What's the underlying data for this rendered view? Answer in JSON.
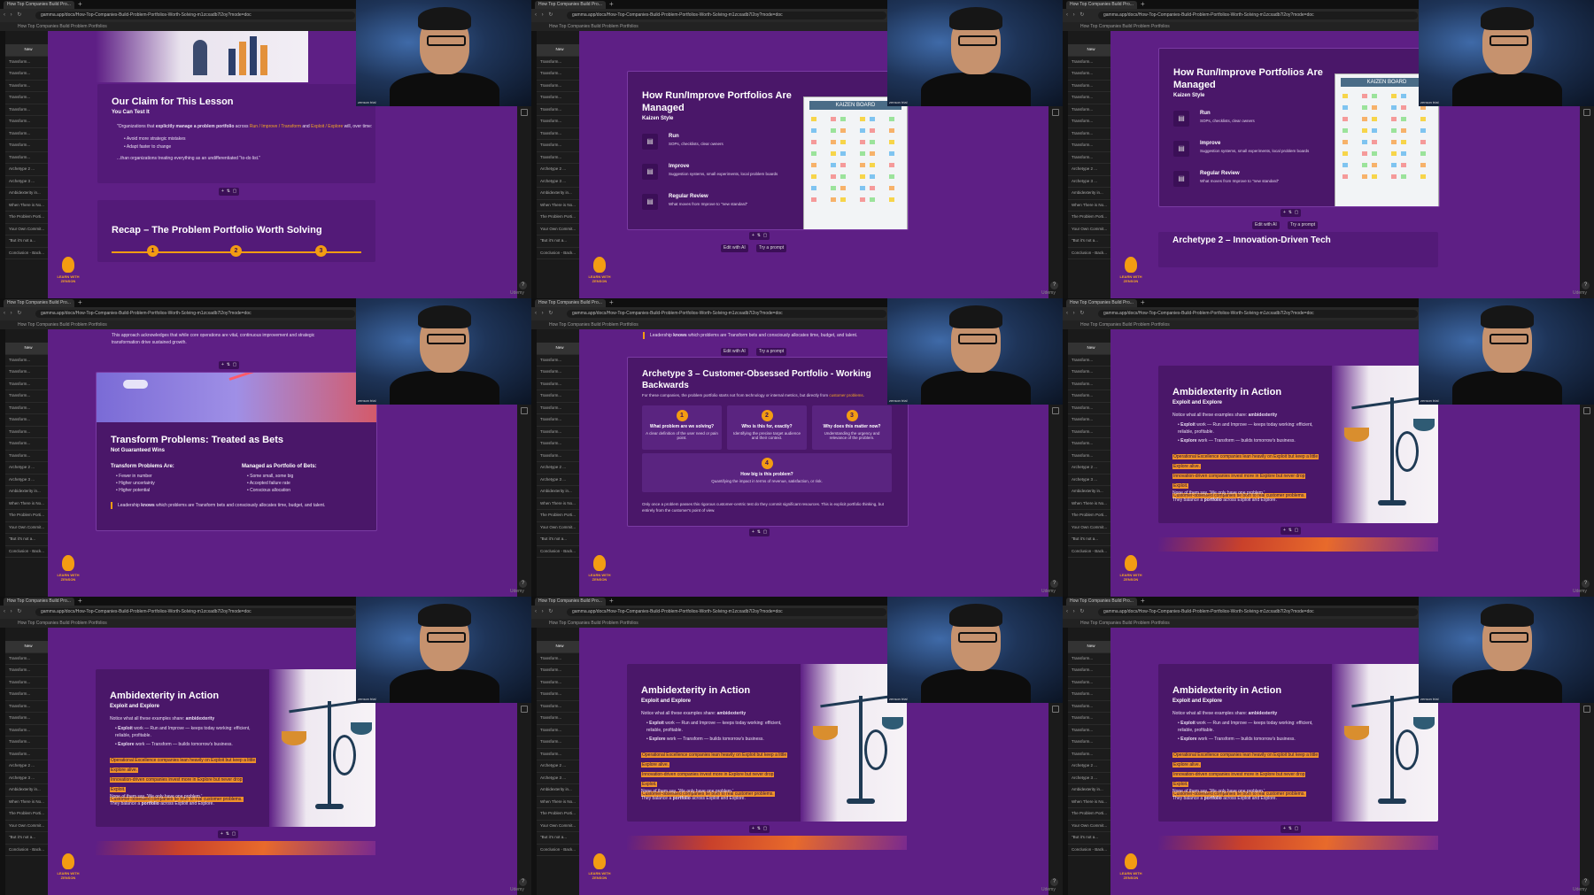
{
  "browser": {
    "tab_title": "How Top Companies Build Pro...",
    "url": "gamma.app/docs/How-Top-Companies-Build-Problem-Portfolios-Worth-Solving-m1zcxadb7l2oy?mode=doc",
    "breadcrumb": "How Top Companies Build Problem Portfolios"
  },
  "outline": {
    "first": "New",
    "items": [
      "Transform...",
      "Transform...",
      "Transform...",
      "Transform...",
      "Transform...",
      "Transform...",
      "Transform...",
      "Transform...",
      "Transform...",
      "Archetype 2 ...",
      "Archetype 3 ...",
      "Ambidexterity in...",
      "When There is No...",
      "The Problem Porti...",
      "Your Own Commit...",
      "\"But it's not a...",
      "Conclusion - Back..."
    ]
  },
  "brand": {
    "logo_text": "LEARN WITH ZENSON",
    "watermark": "Udemy",
    "help": "?",
    "cam_tag": "zenson trial"
  },
  "slides": {
    "claim": {
      "title": "Our Claim for This Lesson",
      "subtitle": "You Can Test It",
      "quote_pre": "\"Organizations that ",
      "quote_bold": "explicitly manage a problem portfolio",
      "quote_mid": " across ",
      "quote_link1": "Run / Improve / Transform",
      "quote_and": " and ",
      "quote_link2": "Exploit / Explore",
      "quote_end": " will, over time:",
      "bullets": [
        "Avoid more strategic mistakes",
        "Adapt faster to change"
      ],
      "closing": "...than organizations treating everything as an undifferentiated \"to-do list.\""
    },
    "recap": {
      "title": "Recap – The Problem Portfolio Worth Solving",
      "nums": [
        "1",
        "2",
        "3"
      ]
    },
    "kaizen": {
      "title": "How Run/Improve Portfolios Are Managed",
      "subtitle": "Kaizen Style",
      "board_label": "KAIZEN BOARD",
      "items": [
        {
          "head": "Run",
          "text": "SOPs, checklists, clear owners"
        },
        {
          "head": "Improve",
          "text": "Suggestion systems, small experiments, local problem boards"
        },
        {
          "head": "Regular Review",
          "text": "What moves from Improve to \"new standard\""
        }
      ]
    },
    "archetype2": {
      "title": "Archetype 2 – Innovation-Driven Tech"
    },
    "ai_buttons": {
      "edit": "Edit with AI",
      "prompt": "Try a prompt"
    },
    "bets": {
      "intro": "This approach acknowledges that while core operations are vital, continuous improvement and strategic transformation drive sustained growth.",
      "title": "Transform Problems: Treated as Bets",
      "subtitle": "Not Guaranteed Wins",
      "col1_head": "Transform Problems Are:",
      "col1": [
        "Fewer in number",
        "Higher uncertainty",
        "Higher potential"
      ],
      "col2_head": "Managed as Portfolio of Bets:",
      "col2": [
        "Some small, some big",
        "Accepted failure rate",
        "Conscious allocation"
      ],
      "footer_pre": "Leadership ",
      "footer_bold": "knows",
      "footer_end": " which problems are Transform bets and consciously allocates time, budget, and talent."
    },
    "archetype3": {
      "top_pre": "Leadership ",
      "top_bold": "knows",
      "top_end": " which problems are Transform bets and consciously allocates time, budget, and talent.",
      "title": "Archetype 3 – Customer-Obsessed Portfolio - Working Backwards",
      "intro_pre": "For these companies, the problem portfolio starts not from technology or internal metrics, but directly from ",
      "intro_link": "customer problems",
      "intro_end": ".",
      "questions": [
        {
          "n": "1",
          "q": "What problem are we solving?",
          "a": "A clear definition of the user need or pain point."
        },
        {
          "n": "2",
          "q": "Who is this for, exactly?",
          "a": "Identifying the precise target audience and their context."
        },
        {
          "n": "3",
          "q": "Why does this matter now?",
          "a": "Understanding the urgency and relevance of the problem."
        },
        {
          "n": "4",
          "q": "How big is this problem?",
          "a": "Quantifying the impact in terms of revenue, satisfaction, or risk."
        }
      ],
      "footer": "Only once a problem passes this rigorous customer-centric test do they commit significant resources. This is explicit portfolio thinking, but entirely from the customer's point of view."
    },
    "ambi": {
      "title": "Ambidexterity in Action",
      "subtitle": "Exploit and Explore",
      "notice_pre": "Notice what all these examples share: ",
      "notice_bold": "ambidexterity",
      "b1_bold": "Exploit",
      "b1": " work — Run and Improve — keeps today working: efficient, reliable, profitable.",
      "b2_bold": "Explore",
      "b2": " work — Transform — builds tomorrow's business.",
      "highlights": [
        "Operational Excellence companies lean heavily on Exploit but keep a little",
        "Explore alive.",
        "Innovation-driven companies invest more in Explore but never drop",
        "Exploit.",
        "Customer-obsessed companies tie both to real customer problems."
      ],
      "none1": "None of them say, 'We only have one problem.'",
      "none2_pre": "They balance a ",
      "none2_bold": "portfolio",
      "none2_end": " across Exploit and Explore."
    }
  }
}
